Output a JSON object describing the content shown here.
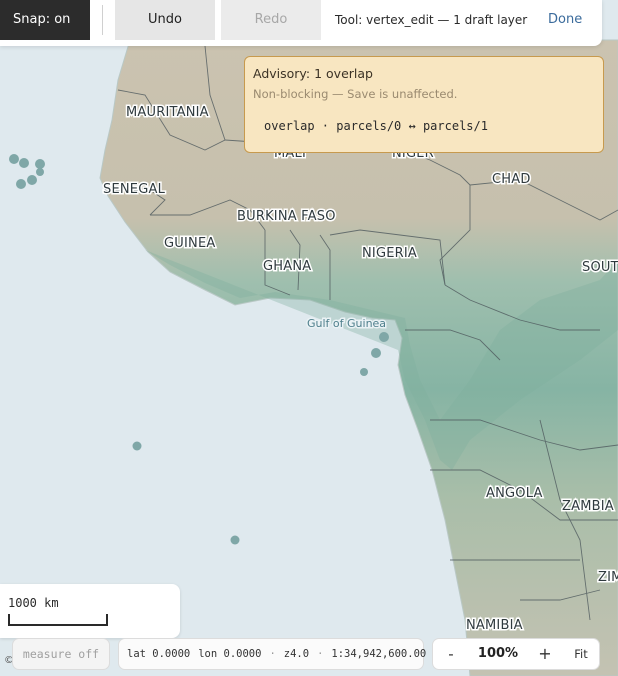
{
  "toolbar": {
    "snap_label": "Snap: on",
    "undo_label": "Undo",
    "redo_label": "Redo",
    "tool_status": "Tool: vertex_edit — 1 draft layer",
    "done_label": "Done"
  },
  "advisory": {
    "title": "Advisory: 1 overlap",
    "subtitle": "Non-blocking — Save is unaffected.",
    "detail": "overlap · parcels/0 ↔ parcels/1"
  },
  "map": {
    "labels": {
      "mauritania": "MAURITANIA",
      "mali": "MALI",
      "niger": "NIGER",
      "chad": "CHAD",
      "senegal": "SENEGAL",
      "burkina_faso": "BURKINA FASO",
      "guinea": "GUINEA",
      "ghana": "GHANA",
      "nigeria": "NIGERIA",
      "south": "SOUT",
      "gulf_of_guinea": "Gulf of Guinea",
      "angola": "ANGOLA",
      "zambia": "ZAMBIA",
      "zimbabwe": "ZIM",
      "namibia": "NAMIBIA"
    },
    "colors": {
      "ocean": "#dfe9ee",
      "land_green": "#8bb8a8",
      "land_tan": "#c9c1ae",
      "border": "#4f5a5e"
    }
  },
  "scale": {
    "label": "1000 km"
  },
  "measure": {
    "label": "measure off"
  },
  "attribution": {
    "symbol": "©"
  },
  "coords": {
    "lat": "lat 0.0000",
    "lon": "lon 0.0000",
    "sep": "·",
    "zoom": "z4.0",
    "scale": "1:34,942,600.00"
  },
  "zoom": {
    "minus": "-",
    "level": "100%",
    "plus": "+",
    "fit": "Fit"
  }
}
